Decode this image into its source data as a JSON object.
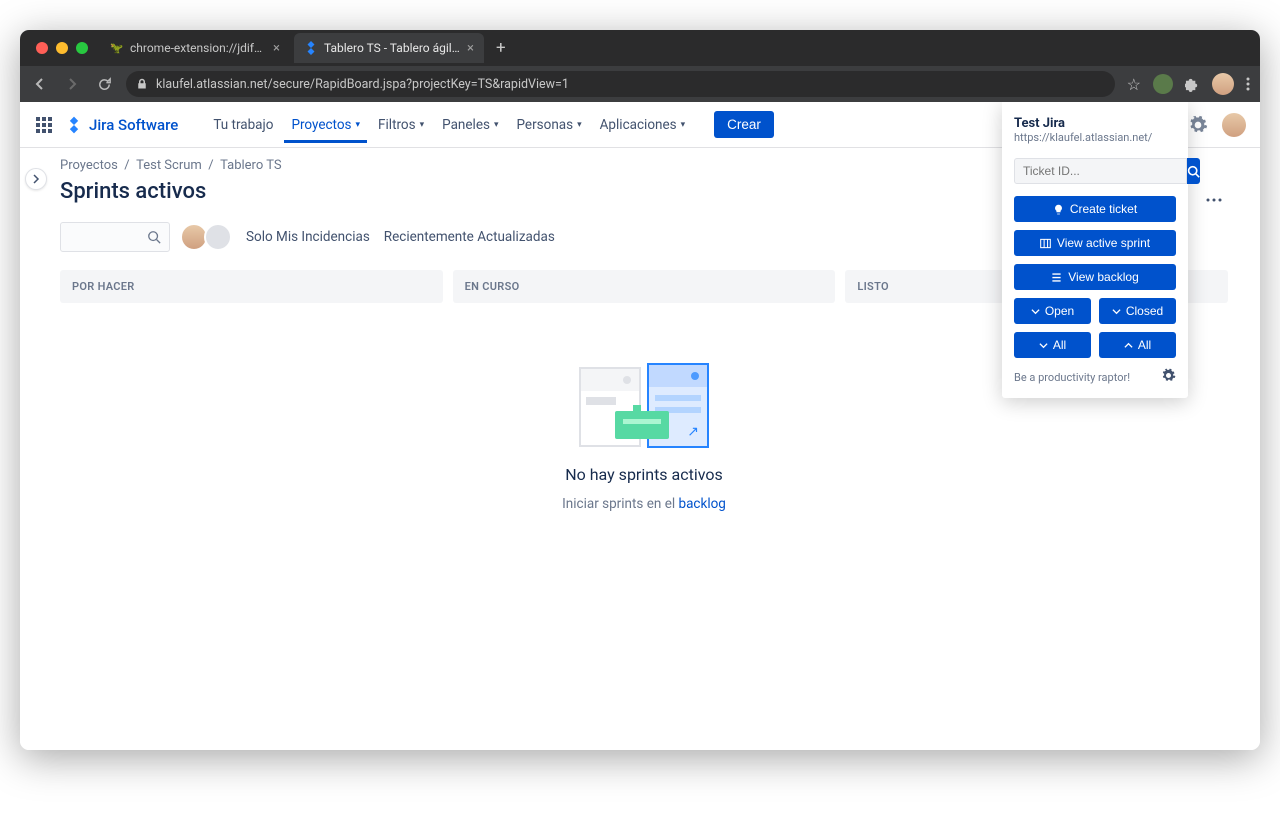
{
  "browser": {
    "tabs": [
      {
        "title": "chrome-extension://jdifpfffme"
      },
      {
        "title": "Tablero TS - Tablero ágil - Jira"
      }
    ],
    "url": "klaufel.atlassian.net/secure/RapidBoard.jspa?projectKey=TS&rapidView=1"
  },
  "header": {
    "product": "Jira Software",
    "nav": {
      "work": "Tu trabajo",
      "projects": "Proyectos",
      "filters": "Filtros",
      "panels": "Paneles",
      "people": "Personas",
      "apps": "Aplicaciones"
    },
    "create": "Crear"
  },
  "breadcrumb": {
    "l1": "Proyectos",
    "l2": "Test Scrum",
    "l3": "Tablero TS"
  },
  "page_title": "Sprints activos",
  "filters": {
    "mine": "Solo Mis Incidencias",
    "recent": "Recientemente Actualizadas"
  },
  "columns": {
    "todo": "POR HACER",
    "inprogress": "EN CURSO",
    "done": "LISTO"
  },
  "empty": {
    "title": "No hay sprints activos",
    "sub_pre": "Iniciar sprints en el ",
    "sub_link": "backlog"
  },
  "ext": {
    "title": "Test Jira",
    "url": "https://klaufel.atlassian.net/",
    "search_placeholder": "Ticket ID...",
    "create": "Create ticket",
    "sprint": "View active sprint",
    "backlog": "View backlog",
    "open": "Open",
    "closed": "Closed",
    "all1": "All",
    "all2": "All",
    "footer": "Be a productivity raptor!"
  }
}
